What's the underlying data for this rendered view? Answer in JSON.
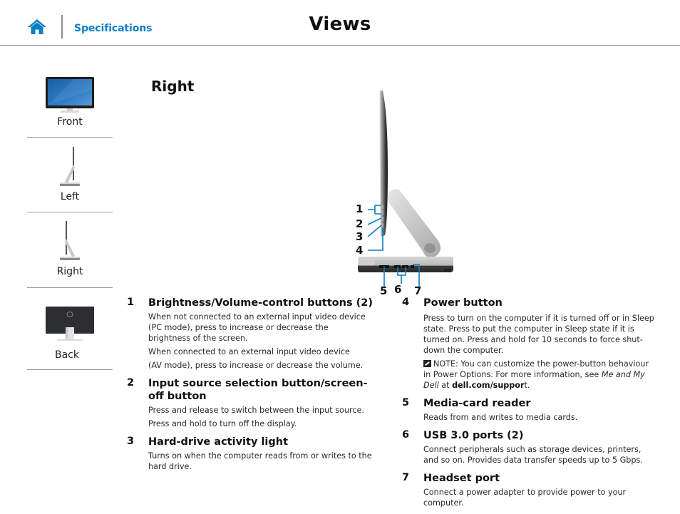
{
  "header": {
    "home_icon": "home-icon",
    "breadcrumb": "Specifications",
    "title": "Views"
  },
  "colors": {
    "accent": "#0a7fc4",
    "divider": "#8c8c8c",
    "callout_line": "#0a7fc4"
  },
  "sidebar": {
    "items": [
      {
        "label": "Front",
        "icon": "monitor-front-icon"
      },
      {
        "label": "Left",
        "icon": "monitor-left-icon"
      },
      {
        "label": "Right",
        "icon": "monitor-right-icon"
      },
      {
        "label": "Back",
        "icon": "monitor-back-icon"
      }
    ]
  },
  "main": {
    "section_title": "Right",
    "callouts": [
      "1",
      "2",
      "3",
      "4",
      "5",
      "6",
      "7"
    ],
    "items_left": [
      {
        "num": "1",
        "title": "Brightness/Volume-control buttons (2)",
        "paragraphs": [
          "When not connected to an external input video device (PC mode), press to increase or decrease the brightness of the screen.",
          "When connected to an external input video device",
          "(AV mode), press to increase or decrease the volume."
        ]
      },
      {
        "num": "2",
        "title": "Input source selection button/screen-off button",
        "paragraphs": [
          "Press and release to switch between the input source.",
          "Press and hold to turn off the display."
        ]
      },
      {
        "num": "3",
        "title": "Hard-drive activity light",
        "paragraphs": [
          "Turns on when the computer reads from or writes to the hard drive."
        ]
      }
    ],
    "items_right": [
      {
        "num": "4",
        "title": "Power button",
        "paragraphs": [
          "Press to turn on the computer if it is turned off or in Sleep state. Press to put the computer in Sleep state if it is turned on. Press and hold for 10 seconds to force shut-down the computer."
        ],
        "note": {
          "icon": "note-pencil-icon",
          "prefix": "NOTE: You can customize the power-button behaviour in Power Options. For more information, see ",
          "italic": "Me and My Dell",
          "middle": " at ",
          "bold": "dell.com/suppor",
          "suffix": "t."
        }
      },
      {
        "num": "5",
        "title": "Media-card reader",
        "paragraphs": [
          "Reads from and writes to media cards."
        ]
      },
      {
        "num": "6",
        "title": "USB 3.0 ports (2)",
        "paragraphs": [
          "Connect peripherals such as storage devices, printers, and so on. Provides data transfer speeds up to 5 Gbps."
        ]
      },
      {
        "num": "7",
        "title": "Headset port",
        "paragraphs": [
          "Connect a power adapter to provide power to your computer."
        ]
      }
    ]
  }
}
